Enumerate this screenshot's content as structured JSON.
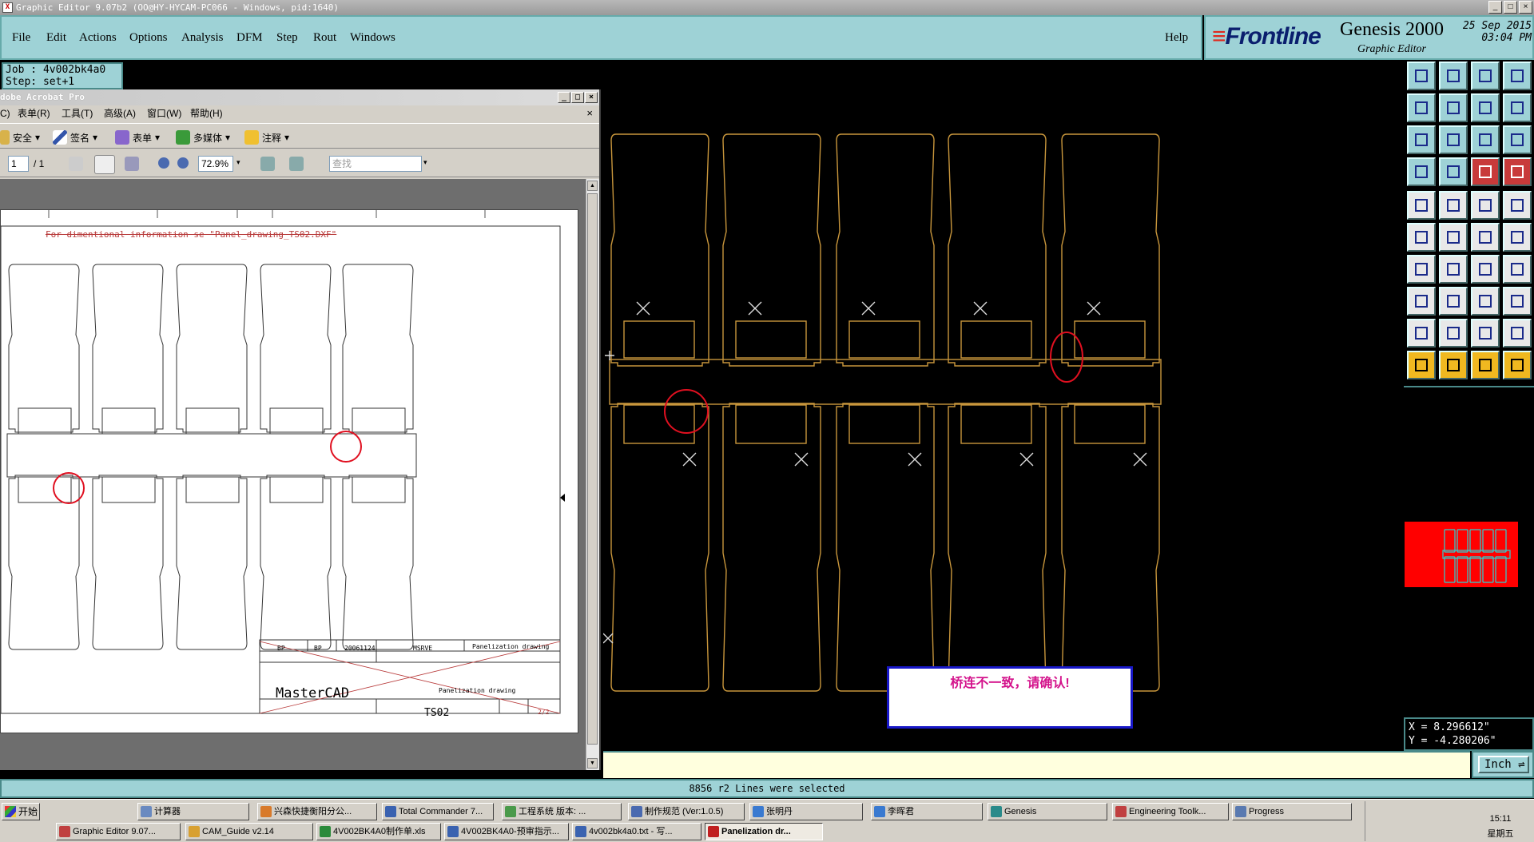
{
  "window": {
    "title": "Graphic Editor 9.07b2 (OO@HY-HYCAM-PC066 - Windows, pid:1640)",
    "controls": [
      "_",
      "□",
      "×"
    ]
  },
  "menu": {
    "items": [
      "File",
      "Edit",
      "Actions",
      "Options",
      "Analysis",
      "DFM",
      "Step",
      "Rout",
      "Windows"
    ],
    "help": "Help"
  },
  "brand": {
    "logo": "Frontline",
    "product": "Genesis 2000",
    "subtitle": "Graphic Editor",
    "date": "25 Sep 2015",
    "time": "03:04 PM"
  },
  "job": {
    "job_line": "Job : 4v002bk4a0",
    "step_line": "Step: set+1"
  },
  "acrobat": {
    "title": "dobe Acrobat Pro",
    "menu": [
      "C)",
      "表单(R)",
      "工具(T)",
      "高级(A)",
      "窗口(W)",
      "帮助(H)"
    ],
    "toolbar1": {
      "security": "安全",
      "sign": "签名",
      "forms": "表单",
      "multimedia": "多媒体",
      "comment": "注释"
    },
    "page_current": "1",
    "page_total": "/ 1",
    "zoom": "72.9%",
    "search_placeholder": "查找",
    "drawing": {
      "note": "For dimentional information se \"Panel_drawing_TS02.DXF\"",
      "company": "MasterCAD",
      "part": "TS02",
      "title_cell": "Panelization drawing",
      "title_cell2": "Panelization drawing",
      "design": "BP",
      "drawn": "BP",
      "date": "20061124",
      "project": "MSRVE",
      "page": "2/2"
    }
  },
  "popup": {
    "message": "桥连不一致，请确认!"
  },
  "coords": {
    "x": "X = 8.296612\"",
    "y": "Y = -4.280206\""
  },
  "units": "Inch",
  "status": "8856 r2 Lines were selected",
  "taskbar": {
    "start": "开始",
    "row1": [
      "计算器",
      "兴森快捷衡阳分公...",
      "Total Commander 7...",
      "工程系统   版本: ...",
      "制作规范 (Ver:1.0.5)",
      "张明丹",
      "李晖君",
      "Genesis",
      "Engineering Toolk...",
      "Progress"
    ],
    "row2": [
      "Graphic Editor 9.07...",
      "CAM_Guide v2.14",
      "4V002BK4A0制作单.xls",
      "4V002BK4A0-预审指示...",
      "4v002bk4a0.txt - 写...",
      "Panelization dr..."
    ],
    "clock_time": "15:11",
    "clock_day": "星期五"
  },
  "colors": {
    "panel_bg": "#9ed2d6",
    "outline": "#c8963c",
    "marker": "#e01020",
    "popup_text": "#d4148c"
  }
}
